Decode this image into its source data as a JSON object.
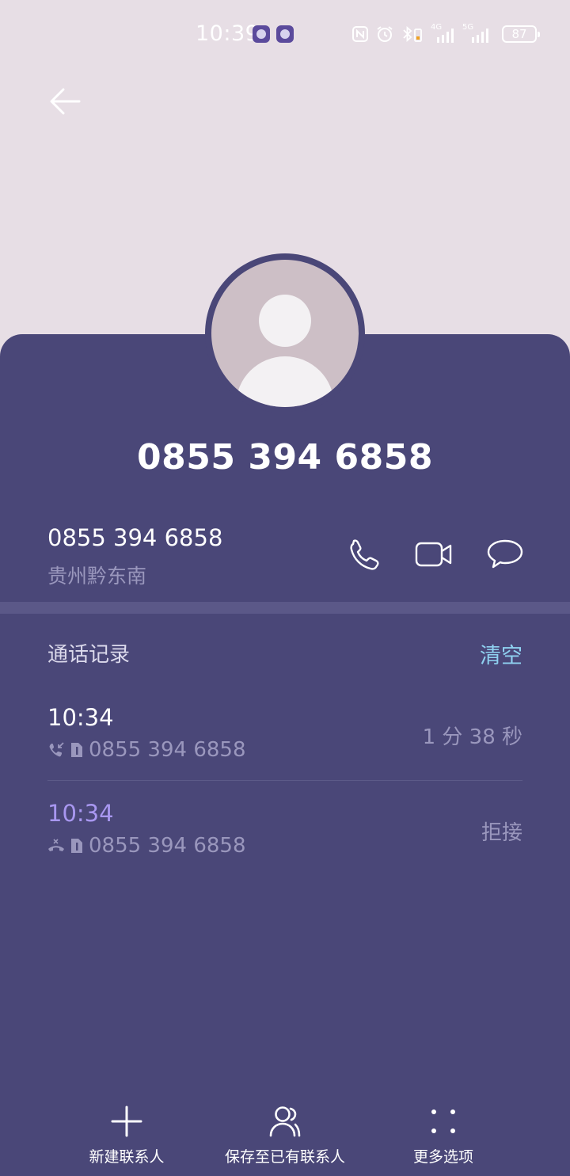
{
  "status_bar": {
    "time": "10:39",
    "battery": "87",
    "signal_1_label": "4G",
    "signal_2_label": "5G"
  },
  "contact": {
    "display_number": "0855 394 6858",
    "number": "0855 394 6858",
    "location": "贵州黔东南"
  },
  "history": {
    "title": "通话记录",
    "clear_label": "清空",
    "entries": [
      {
        "time": "10:34",
        "number": "0855 394 6858",
        "status": "1 分 38 秒",
        "type": "incoming"
      },
      {
        "time": "10:34",
        "number": "0855 394 6858",
        "status": "拒接",
        "type": "rejected"
      }
    ]
  },
  "bottom_bar": {
    "new_contact": "新建联系人",
    "save_existing": "保存至已有联系人",
    "more_options": "更多选项"
  },
  "colors": {
    "header_bg": "#e7dee5",
    "card_bg": "#4a4778",
    "accent_link": "#8fd1f0",
    "missed_time": "#a897f0"
  }
}
